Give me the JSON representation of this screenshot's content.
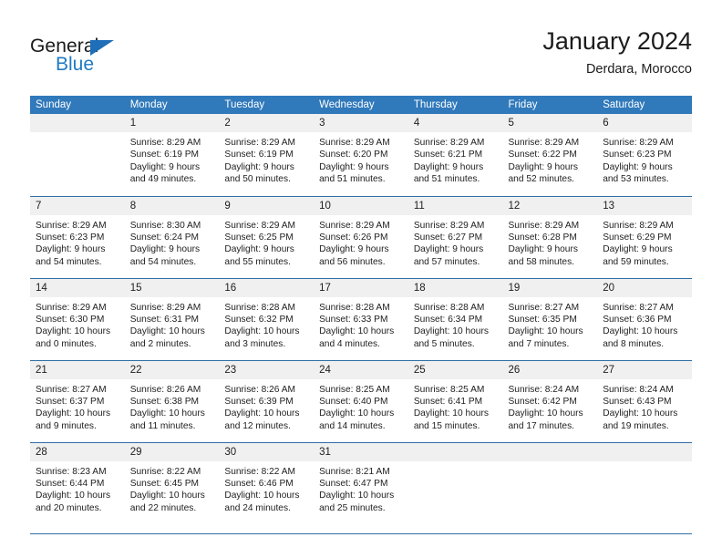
{
  "brand": {
    "line1": "General",
    "line2": "Blue",
    "accent_color": "#1f7ac4"
  },
  "header": {
    "title": "January 2024",
    "subtitle": "Derdara, Morocco"
  },
  "theme": {
    "header_blue": "#3079bb",
    "daynum_band": "#f0f0f0",
    "rule": "#2f6ea6"
  },
  "weekday_headers": [
    "Sunday",
    "Monday",
    "Tuesday",
    "Wednesday",
    "Thursday",
    "Friday",
    "Saturday"
  ],
  "weeks": [
    [
      {
        "day": "",
        "lines": []
      },
      {
        "day": "1",
        "lines": [
          "Sunrise: 8:29 AM",
          "Sunset: 6:19 PM",
          "Daylight: 9 hours",
          "and 49 minutes."
        ]
      },
      {
        "day": "2",
        "lines": [
          "Sunrise: 8:29 AM",
          "Sunset: 6:19 PM",
          "Daylight: 9 hours",
          "and 50 minutes."
        ]
      },
      {
        "day": "3",
        "lines": [
          "Sunrise: 8:29 AM",
          "Sunset: 6:20 PM",
          "Daylight: 9 hours",
          "and 51 minutes."
        ]
      },
      {
        "day": "4",
        "lines": [
          "Sunrise: 8:29 AM",
          "Sunset: 6:21 PM",
          "Daylight: 9 hours",
          "and 51 minutes."
        ]
      },
      {
        "day": "5",
        "lines": [
          "Sunrise: 8:29 AM",
          "Sunset: 6:22 PM",
          "Daylight: 9 hours",
          "and 52 minutes."
        ]
      },
      {
        "day": "6",
        "lines": [
          "Sunrise: 8:29 AM",
          "Sunset: 6:23 PM",
          "Daylight: 9 hours",
          "and 53 minutes."
        ]
      }
    ],
    [
      {
        "day": "7",
        "lines": [
          "Sunrise: 8:29 AM",
          "Sunset: 6:23 PM",
          "Daylight: 9 hours",
          "and 54 minutes."
        ]
      },
      {
        "day": "8",
        "lines": [
          "Sunrise: 8:30 AM",
          "Sunset: 6:24 PM",
          "Daylight: 9 hours",
          "and 54 minutes."
        ]
      },
      {
        "day": "9",
        "lines": [
          "Sunrise: 8:29 AM",
          "Sunset: 6:25 PM",
          "Daylight: 9 hours",
          "and 55 minutes."
        ]
      },
      {
        "day": "10",
        "lines": [
          "Sunrise: 8:29 AM",
          "Sunset: 6:26 PM",
          "Daylight: 9 hours",
          "and 56 minutes."
        ]
      },
      {
        "day": "11",
        "lines": [
          "Sunrise: 8:29 AM",
          "Sunset: 6:27 PM",
          "Daylight: 9 hours",
          "and 57 minutes."
        ]
      },
      {
        "day": "12",
        "lines": [
          "Sunrise: 8:29 AM",
          "Sunset: 6:28 PM",
          "Daylight: 9 hours",
          "and 58 minutes."
        ]
      },
      {
        "day": "13",
        "lines": [
          "Sunrise: 8:29 AM",
          "Sunset: 6:29 PM",
          "Daylight: 9 hours",
          "and 59 minutes."
        ]
      }
    ],
    [
      {
        "day": "14",
        "lines": [
          "Sunrise: 8:29 AM",
          "Sunset: 6:30 PM",
          "Daylight: 10 hours",
          "and 0 minutes."
        ]
      },
      {
        "day": "15",
        "lines": [
          "Sunrise: 8:29 AM",
          "Sunset: 6:31 PM",
          "Daylight: 10 hours",
          "and 2 minutes."
        ]
      },
      {
        "day": "16",
        "lines": [
          "Sunrise: 8:28 AM",
          "Sunset: 6:32 PM",
          "Daylight: 10 hours",
          "and 3 minutes."
        ]
      },
      {
        "day": "17",
        "lines": [
          "Sunrise: 8:28 AM",
          "Sunset: 6:33 PM",
          "Daylight: 10 hours",
          "and 4 minutes."
        ]
      },
      {
        "day": "18",
        "lines": [
          "Sunrise: 8:28 AM",
          "Sunset: 6:34 PM",
          "Daylight: 10 hours",
          "and 5 minutes."
        ]
      },
      {
        "day": "19",
        "lines": [
          "Sunrise: 8:27 AM",
          "Sunset: 6:35 PM",
          "Daylight: 10 hours",
          "and 7 minutes."
        ]
      },
      {
        "day": "20",
        "lines": [
          "Sunrise: 8:27 AM",
          "Sunset: 6:36 PM",
          "Daylight: 10 hours",
          "and 8 minutes."
        ]
      }
    ],
    [
      {
        "day": "21",
        "lines": [
          "Sunrise: 8:27 AM",
          "Sunset: 6:37 PM",
          "Daylight: 10 hours",
          "and 9 minutes."
        ]
      },
      {
        "day": "22",
        "lines": [
          "Sunrise: 8:26 AM",
          "Sunset: 6:38 PM",
          "Daylight: 10 hours",
          "and 11 minutes."
        ]
      },
      {
        "day": "23",
        "lines": [
          "Sunrise: 8:26 AM",
          "Sunset: 6:39 PM",
          "Daylight: 10 hours",
          "and 12 minutes."
        ]
      },
      {
        "day": "24",
        "lines": [
          "Sunrise: 8:25 AM",
          "Sunset: 6:40 PM",
          "Daylight: 10 hours",
          "and 14 minutes."
        ]
      },
      {
        "day": "25",
        "lines": [
          "Sunrise: 8:25 AM",
          "Sunset: 6:41 PM",
          "Daylight: 10 hours",
          "and 15 minutes."
        ]
      },
      {
        "day": "26",
        "lines": [
          "Sunrise: 8:24 AM",
          "Sunset: 6:42 PM",
          "Daylight: 10 hours",
          "and 17 minutes."
        ]
      },
      {
        "day": "27",
        "lines": [
          "Sunrise: 8:24 AM",
          "Sunset: 6:43 PM",
          "Daylight: 10 hours",
          "and 19 minutes."
        ]
      }
    ],
    [
      {
        "day": "28",
        "lines": [
          "Sunrise: 8:23 AM",
          "Sunset: 6:44 PM",
          "Daylight: 10 hours",
          "and 20 minutes."
        ]
      },
      {
        "day": "29",
        "lines": [
          "Sunrise: 8:22 AM",
          "Sunset: 6:45 PM",
          "Daylight: 10 hours",
          "and 22 minutes."
        ]
      },
      {
        "day": "30",
        "lines": [
          "Sunrise: 8:22 AM",
          "Sunset: 6:46 PM",
          "Daylight: 10 hours",
          "and 24 minutes."
        ]
      },
      {
        "day": "31",
        "lines": [
          "Sunrise: 8:21 AM",
          "Sunset: 6:47 PM",
          "Daylight: 10 hours",
          "and 25 minutes."
        ]
      },
      {
        "day": "",
        "lines": []
      },
      {
        "day": "",
        "lines": []
      },
      {
        "day": "",
        "lines": []
      }
    ]
  ]
}
